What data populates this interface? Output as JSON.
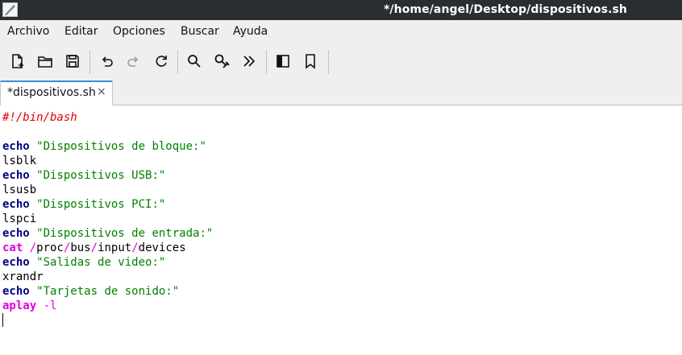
{
  "window": {
    "title": "*/home/angel/Desktop/dispositivos.sh"
  },
  "menu": {
    "items": [
      "Archivo",
      "Editar",
      "Opciones",
      "Buscar",
      "Ayuda"
    ]
  },
  "toolbar": {
    "buttons": [
      "new-document-icon",
      "open-folder-icon",
      "save-icon",
      "undo-icon",
      "redo-icon",
      "reload-icon",
      "search-icon",
      "replace-icon",
      "go-to-line-icon",
      "side-pane-icon",
      "bookmark-icon"
    ]
  },
  "tab": {
    "label": "*dispositivos.sh",
    "close": "×"
  },
  "code": {
    "line1": {
      "comment": "#!/bin/bash"
    },
    "line3": {
      "kw": "echo",
      "str": "\"Dispositivos de bloque:\""
    },
    "line4": {
      "text": "lsblk"
    },
    "line5": {
      "kw": "echo",
      "str": "\"Dispositivos USB:\""
    },
    "line6": {
      "text": "lsusb"
    },
    "line7": {
      "kw": "echo",
      "str": "\"Dispositivos PCI:\""
    },
    "line8": {
      "text": "lspci"
    },
    "line9": {
      "kw": "echo",
      "str": "\"Dispositivos de entrada:\""
    },
    "line10": {
      "cmd": "cat",
      "p1": "/",
      "w1": "proc",
      "p2": "/",
      "w2": "bus",
      "p3": "/",
      "w3": "input",
      "p4": "/",
      "w4": "devices"
    },
    "line11": {
      "kw": "echo",
      "str": "\"Salidas de video:\""
    },
    "line12": {
      "text": "xrandr"
    },
    "line13": {
      "kw": "echo",
      "str": "\"Tarjetas de sonido:\""
    },
    "line14": {
      "cmd": "aplay",
      "opt": "-l"
    }
  },
  "colors": {
    "titlebar": "#2b2e31",
    "chrome": "#efefef",
    "keyword": "#000080",
    "string": "#008000",
    "comment": "#e00000",
    "command": "#e000e0",
    "tab_accent": "#3f8ae2"
  }
}
